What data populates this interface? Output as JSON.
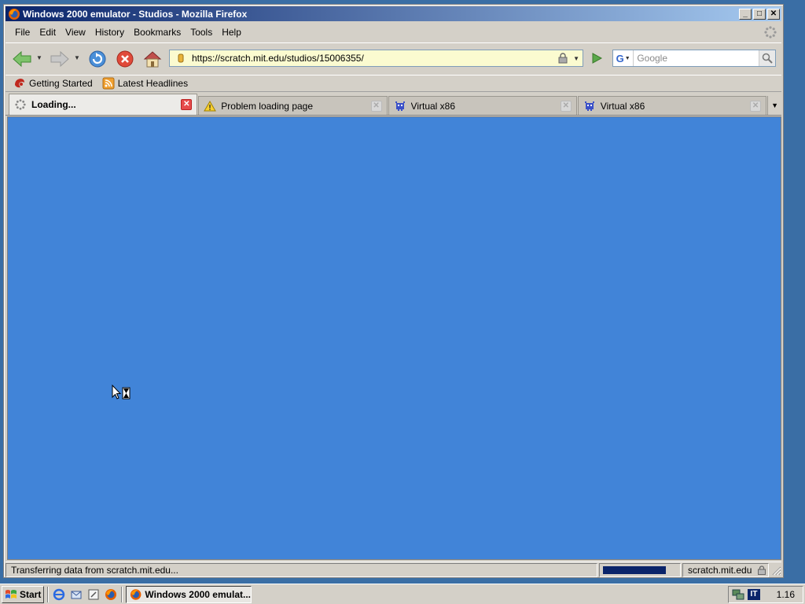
{
  "window": {
    "title": "Windows 2000 emulator - Studios - Mozilla Firefox",
    "controls": {
      "minimize": "_",
      "maximize": "□",
      "close": "✕"
    }
  },
  "menu": [
    "File",
    "Edit",
    "View",
    "History",
    "Bookmarks",
    "Tools",
    "Help"
  ],
  "navigation": {
    "url": "https://scratch.mit.edu/studios/15006355/",
    "search_engine": "G",
    "search_placeholder": "Google"
  },
  "bookmarks": [
    {
      "label": "Getting Started",
      "icon": "firefox-getting-started-icon"
    },
    {
      "label": "Latest Headlines",
      "icon": "rss-feed-icon"
    }
  ],
  "tabs": [
    {
      "label": "Loading...",
      "icon": "loading-spinner-icon",
      "active": true
    },
    {
      "label": "Problem loading page",
      "icon": "warning-icon",
      "active": false
    },
    {
      "label": "Virtual x86",
      "icon": "virtual-x86-icon",
      "active": false
    },
    {
      "label": "Virtual x86",
      "icon": "virtual-x86-icon",
      "active": false
    }
  ],
  "content": {
    "background": "#4184d8"
  },
  "status": {
    "text": "Transferring data from scratch.mit.edu...",
    "progress": 0.85,
    "domain": "scratch.mit.edu"
  },
  "taskbar": {
    "start_label": "Start",
    "task_label": "Windows 2000 emulat...",
    "language": "IT",
    "clock": "1.16"
  },
  "colors": {
    "titlebar_start": "#0a246a",
    "titlebar_end": "#a6caf0",
    "desktop": "#3a6ea5",
    "progress": "#0a246a"
  }
}
